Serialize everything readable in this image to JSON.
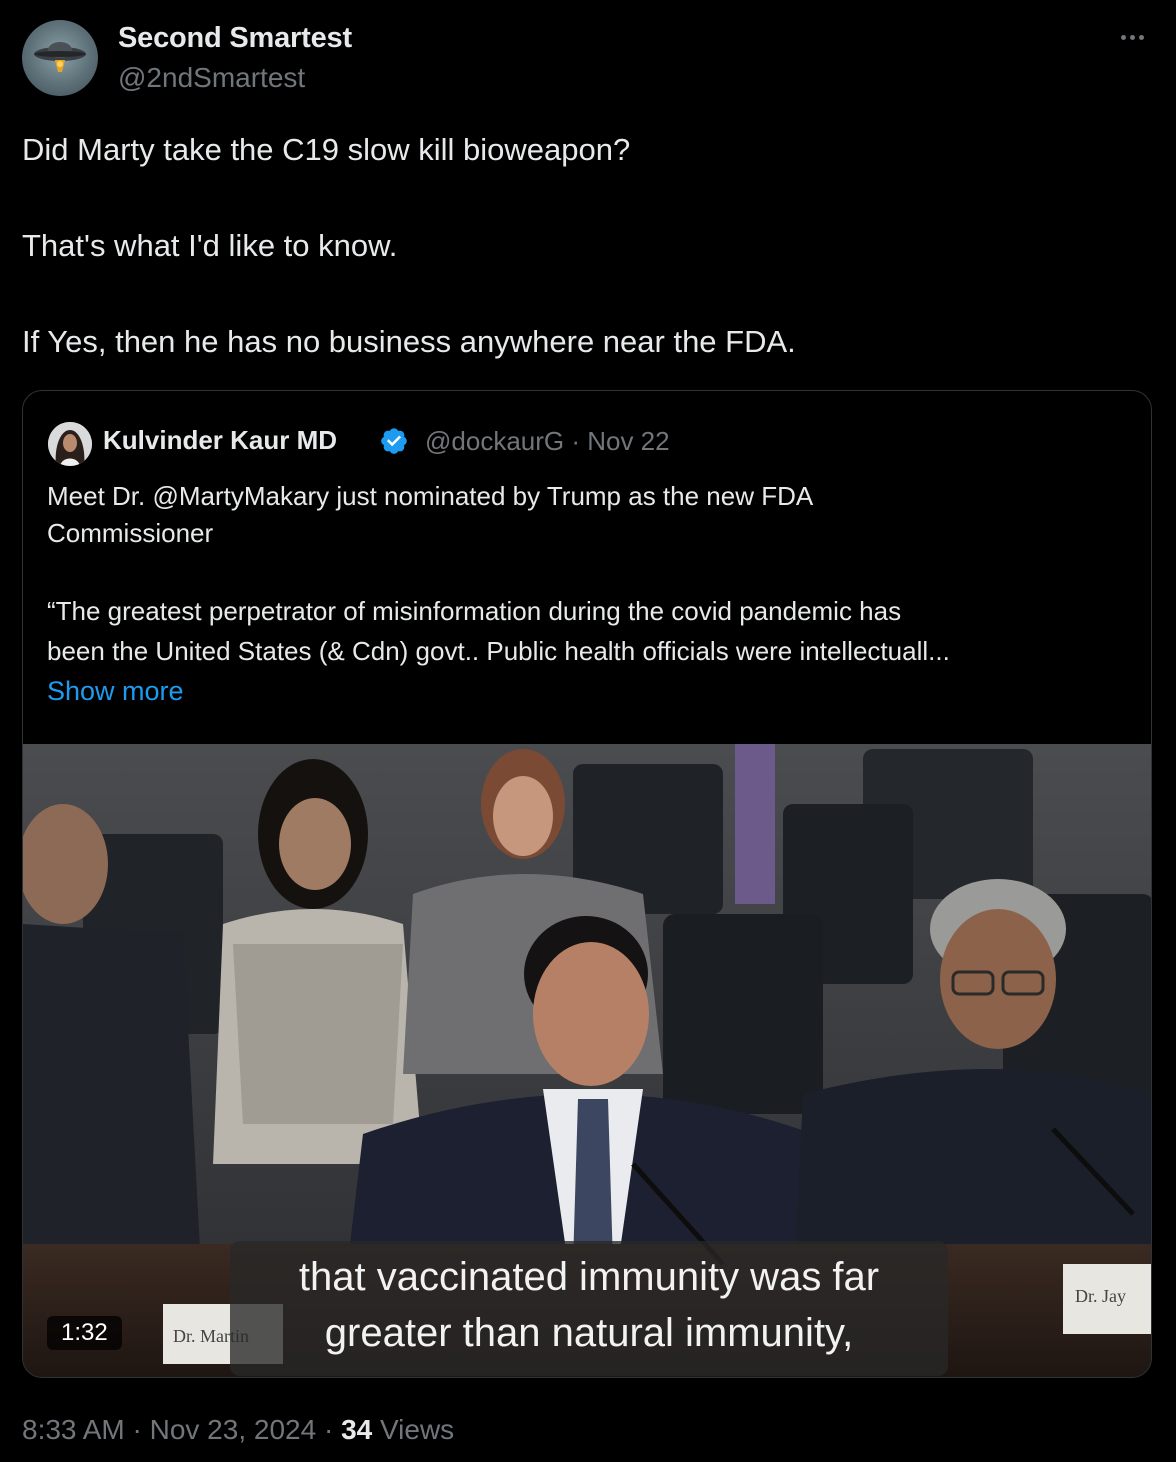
{
  "author": {
    "display_name": "Second Smartest",
    "handle": "@2ndSmartest"
  },
  "tweet": {
    "lines": [
      "Did Marty take the C19 slow kill bioweapon?",
      "That's what I'd like to know.",
      "If Yes, then he has no business anywhere near the FDA."
    ]
  },
  "quote": {
    "display_name": "Kulvinder Kaur MD",
    "handle_date": "@dockaurG · Nov 22",
    "text_lines": [
      "Meet Dr. @MartyMakary just nominated by Trump as the new FDA",
      "Commissioner",
      "“The greatest perpetrator of misinformation during the covid pandemic has",
      "been the United States (& Cdn) govt.. Public health officials were intellectuall..."
    ],
    "show_more": "Show more",
    "video": {
      "caption_lines": [
        "that vaccinated immunity was far",
        "greater than natural immunity,"
      ],
      "duration": "1:32",
      "nameplate_left": "Dr. Martin",
      "nameplate_right": "Dr. Jay"
    }
  },
  "footer": {
    "time": "8:33 AM · Nov 23, 2024 · ",
    "views_count": "34",
    "views_label": " Views"
  },
  "colors": {
    "background": "#000000",
    "text": "#e7e9ea",
    "secondary": "#71767b",
    "link": "#1d9bf0",
    "border": "#2f3336",
    "verified": "#1d9bf0"
  }
}
